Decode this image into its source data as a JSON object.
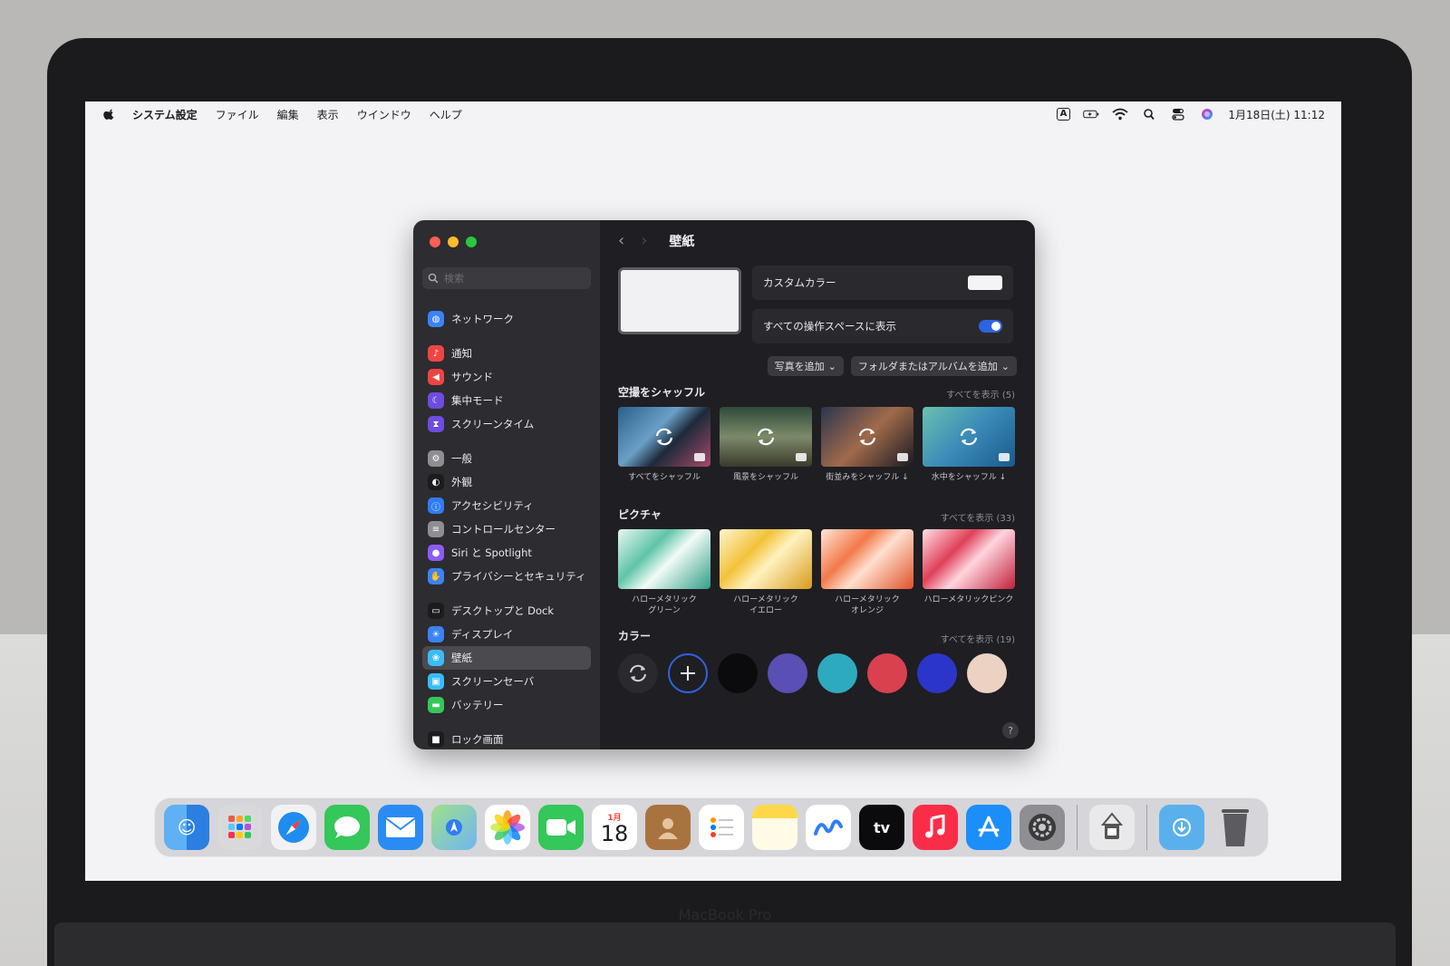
{
  "menubar": {
    "app_name": "システム設定",
    "menus": [
      "ファイル",
      "編集",
      "表示",
      "ウインドウ",
      "ヘルプ"
    ],
    "input_indicator": "A",
    "datetime": "1月18日(土) 11:12"
  },
  "window": {
    "search_placeholder": "検索",
    "sidebar": {
      "group1": [
        {
          "label": "ネットワーク",
          "icon": "globe-icon",
          "color": "#3b82f6"
        }
      ],
      "group2": [
        {
          "label": "通知",
          "icon": "bell-icon",
          "color": "#ef4444"
        },
        {
          "label": "サウンド",
          "icon": "speaker-icon",
          "color": "#ef4444"
        },
        {
          "label": "集中モード",
          "icon": "moon-icon",
          "color": "#6d4ce0"
        },
        {
          "label": "スクリーンタイム",
          "icon": "hourglass-icon",
          "color": "#6d4ce0"
        }
      ],
      "group3": [
        {
          "label": "一般",
          "icon": "gear-icon",
          "color": "#8e8e93"
        },
        {
          "label": "外観",
          "icon": "appearance-icon",
          "color": "#1c1c1e"
        },
        {
          "label": "アクセシビリティ",
          "icon": "accessibility-icon",
          "color": "#2f7cf6"
        },
        {
          "label": "コントロールセンター",
          "icon": "toggles-icon",
          "color": "#8e8e93"
        },
        {
          "label": "Siri と Spotlight",
          "icon": "siri-icon",
          "color": "#8b5cf6"
        },
        {
          "label": "プライバシーとセキュリティ",
          "icon": "hand-icon",
          "color": "#3b82f6"
        }
      ],
      "group4": [
        {
          "label": "デスクトップと Dock",
          "icon": "desktop-icon",
          "color": "#1c1c1e"
        },
        {
          "label": "ディスプレイ",
          "icon": "sun-icon",
          "color": "#3b82f6"
        },
        {
          "label": "壁紙",
          "icon": "wallpaper-icon",
          "color": "#38bdf8",
          "selected": true
        },
        {
          "label": "スクリーンセーバ",
          "icon": "screensaver-icon",
          "color": "#38bdf8"
        },
        {
          "label": "バッテリー",
          "icon": "battery-icon",
          "color": "#34c759"
        }
      ],
      "group5": [
        {
          "label": "ロック画面",
          "icon": "lock-icon",
          "color": "#1c1c1e"
        }
      ]
    },
    "title": "壁紙",
    "custom_color_label": "カスタムカラー",
    "all_spaces_label": "すべての操作スペースに表示",
    "add_photo_label": "写真を追加",
    "add_folder_label": "フォルダまたはアルバムを追加",
    "aerial": {
      "title": "空撮をシャッフル",
      "see_all": "すべてを表示 (5)",
      "items": [
        {
          "label": "すべてをシャッフル"
        },
        {
          "label": "風景をシャッフル"
        },
        {
          "label": "街並みをシャッフル ↓"
        },
        {
          "label": "水中をシャッフル ↓"
        }
      ]
    },
    "pictures": {
      "title": "ピクチャ",
      "see_all": "すべてを表示 (33)",
      "items": [
        {
          "label": "ハローメタリック\nグリーン"
        },
        {
          "label": "ハローメタリック\nイエロー"
        },
        {
          "label": "ハローメタリック\nオレンジ"
        },
        {
          "label": "ハローメタリックピンク"
        }
      ]
    },
    "colors": {
      "title": "カラー",
      "see_all": "すべてを表示 (19)",
      "swatches": [
        "#0b0b0d",
        "#5a4fb5",
        "#2eaabf",
        "#d9414f",
        "#2c35c9",
        "#ecd2c2"
      ]
    },
    "help": "?"
  },
  "dock": {
    "calendar_month": "1月",
    "calendar_day": "18",
    "tv_label": "tv"
  },
  "laptop_label": "MacBook Pro"
}
